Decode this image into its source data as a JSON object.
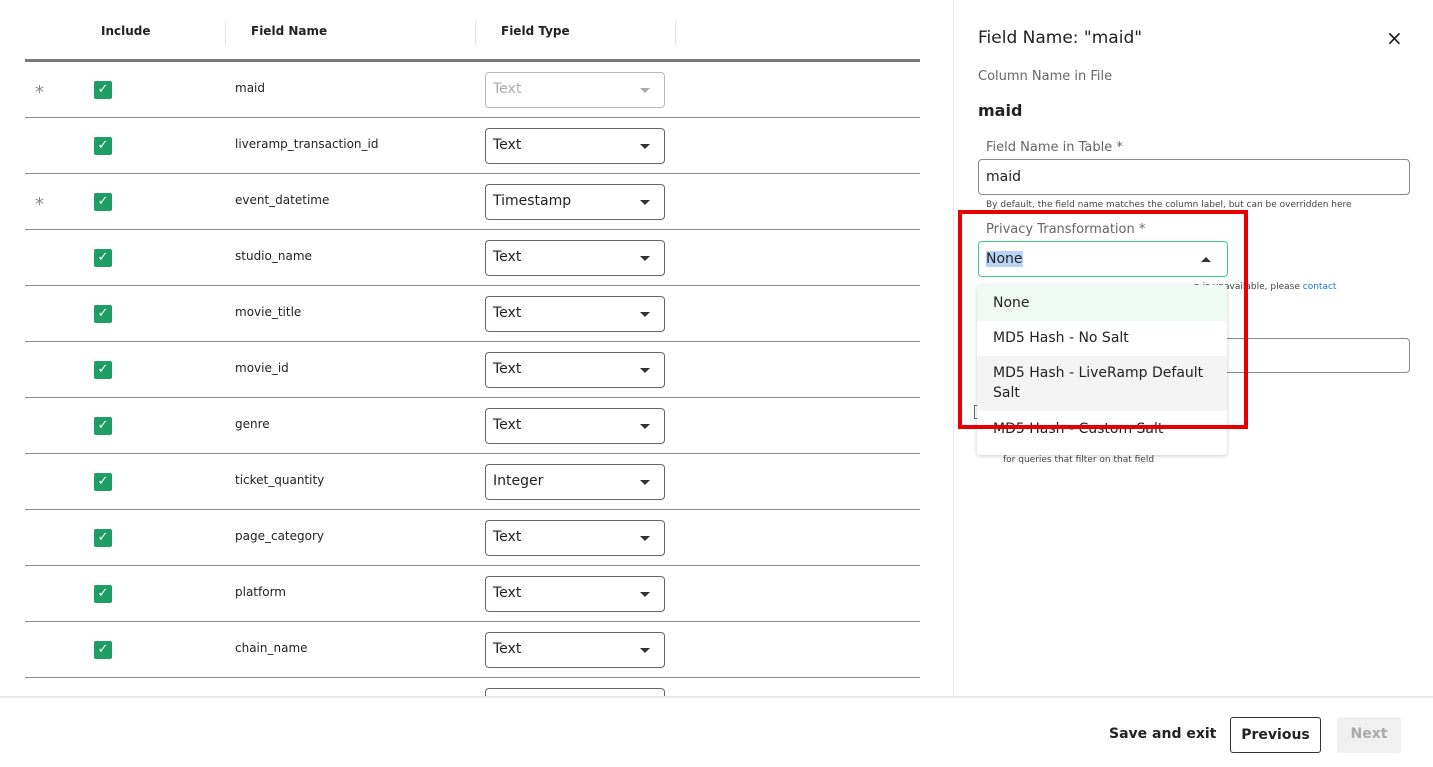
{
  "table": {
    "headers": [
      "Include",
      "Field Name",
      "Field Type"
    ],
    "rows": [
      {
        "required": "*",
        "included": true,
        "name": "maid",
        "type": "Text",
        "disabled": true
      },
      {
        "required": "",
        "included": true,
        "name": "liveramp_transaction_id",
        "type": "Text"
      },
      {
        "required": "*",
        "included": true,
        "name": "event_datetime",
        "type": "Timestamp"
      },
      {
        "required": "",
        "included": true,
        "name": "studio_name",
        "type": "Text"
      },
      {
        "required": "",
        "included": true,
        "name": "movie_title",
        "type": "Text"
      },
      {
        "required": "",
        "included": true,
        "name": "movie_id",
        "type": "Text"
      },
      {
        "required": "",
        "included": true,
        "name": "genre",
        "type": "Text"
      },
      {
        "required": "",
        "included": true,
        "name": "ticket_quantity",
        "type": "Integer"
      },
      {
        "required": "",
        "included": true,
        "name": "page_category",
        "type": "Text"
      },
      {
        "required": "",
        "included": true,
        "name": "platform",
        "type": "Text"
      },
      {
        "required": "",
        "included": true,
        "name": "chain_name",
        "type": "Text"
      }
    ]
  },
  "panel": {
    "title": "Field Name: \"maid\"",
    "column_label": "Column Name in File",
    "column_value": "maid",
    "field_name_label": "Field Name in Table",
    "field_name_value": "maid",
    "field_name_help": "By default, the field name matches the column label, but can be overridden here",
    "privacy_label": "Privacy Transformation",
    "privacy_value": "None",
    "privacy_help_partial": "n is unavailable, please",
    "privacy_help_link": "contact",
    "filter_help": "for queries that filter on that field",
    "options": [
      "None",
      "MD5 Hash - No Salt",
      "MD5 Hash - LiveRamp Default Salt",
      "MD5 Hash - Custom Salt"
    ]
  },
  "footer": {
    "save_exit": "Save and exit",
    "previous": "Previous",
    "next": "Next"
  },
  "colors": {
    "accent": "#1e9e62",
    "highlight": "#e60000",
    "link": "#1a73e8"
  }
}
